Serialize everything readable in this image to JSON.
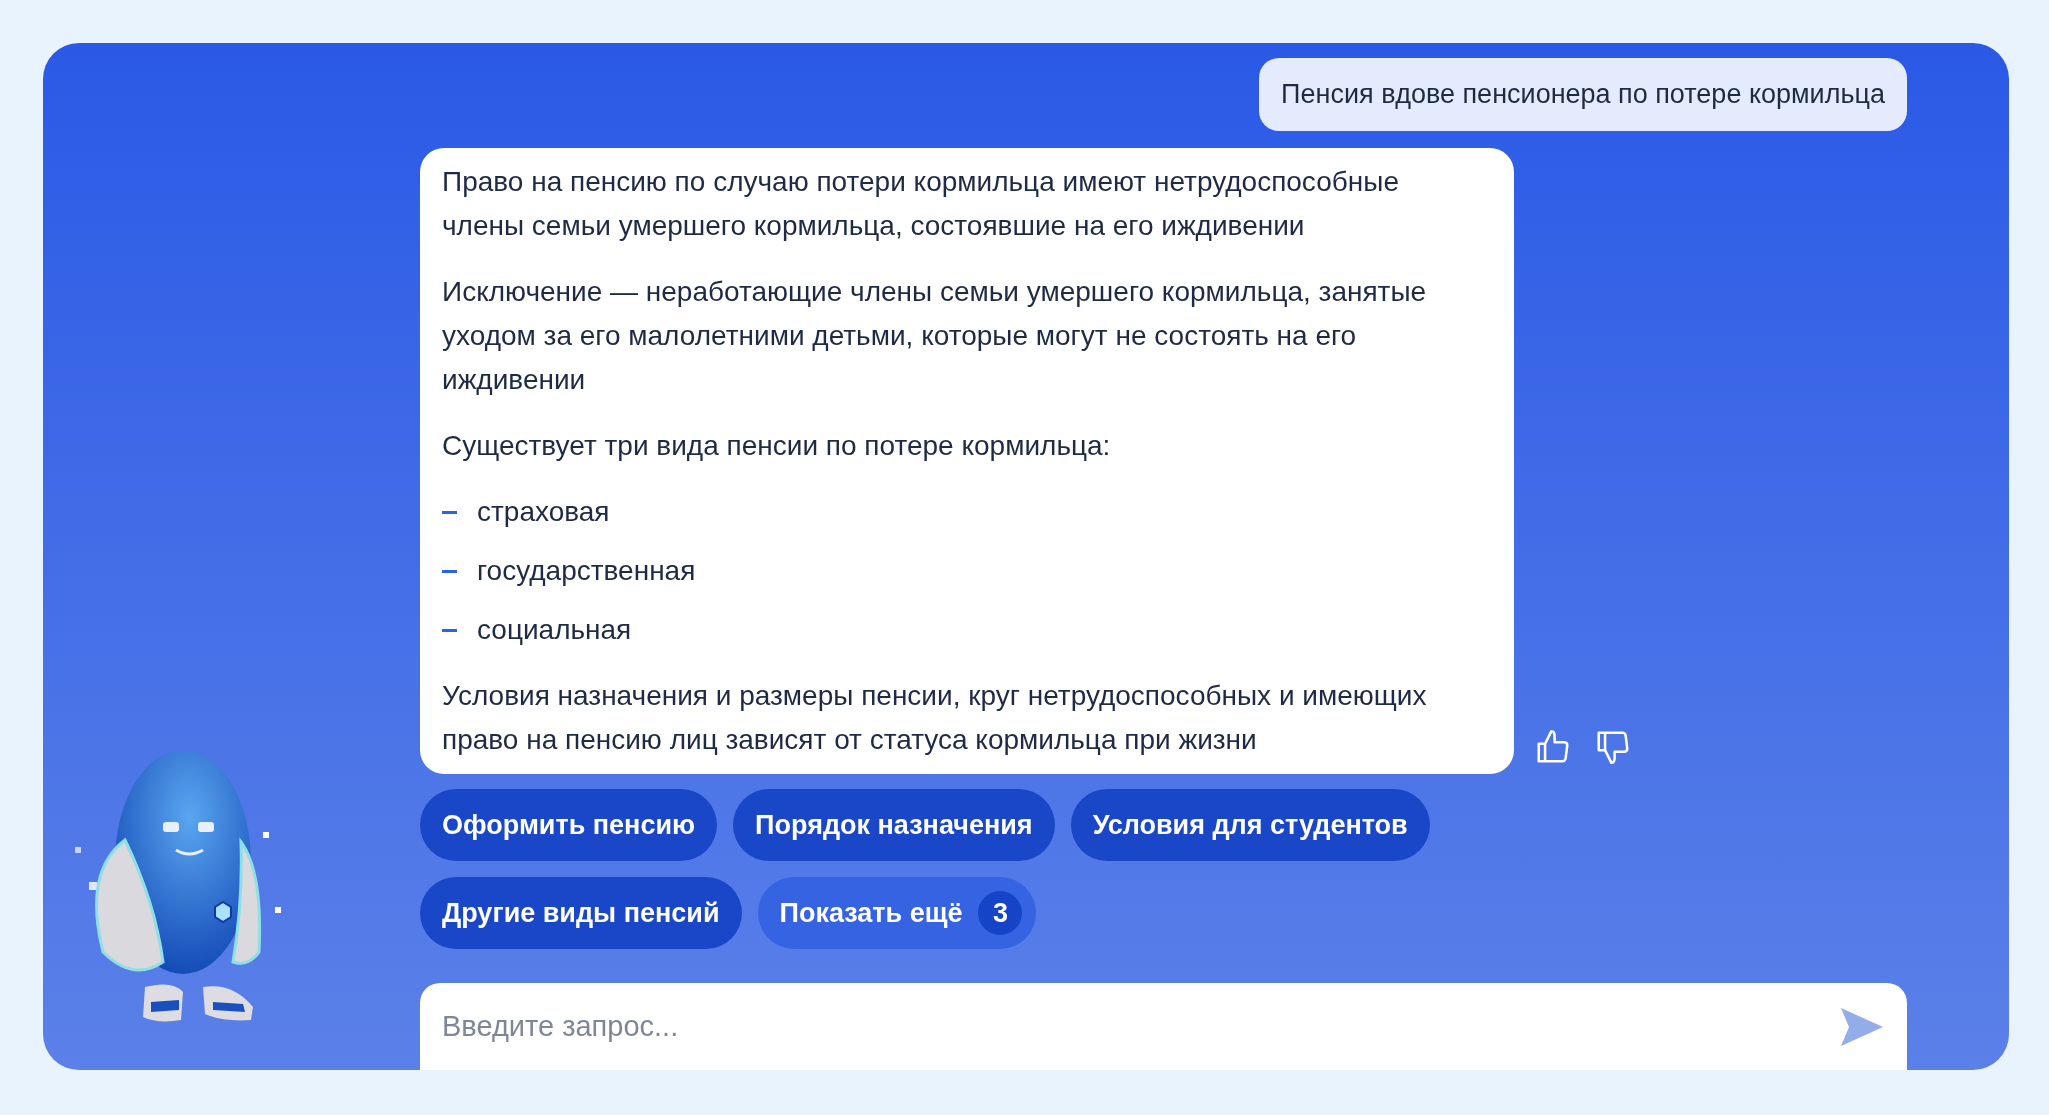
{
  "user_message": "Пенсия вдове пенсионера по потере кормильца",
  "answer": [
    {
      "kind": "paragraph",
      "text": "Право на пенсию по случаю потери кормильца имеют нетрудоспособные члены семьи умершего кормильца, состоявшие на его иждивении"
    },
    {
      "kind": "paragraph",
      "text": "Исключение — неработающие члены семьи умершего кормильца, занятые уходом за его малолетними детьми, которые могут не состоять на его иждивении"
    },
    {
      "kind": "paragraph",
      "text": "Существует три вида пенсии по потере кормильца:"
    },
    {
      "kind": "list",
      "items": [
        "страховая",
        "государственная",
        "социальная"
      ]
    },
    {
      "kind": "paragraph",
      "text": "Условия назначения и размеры пенсии, круг нетрудоспособных и имеющих право на пенсию лиц зависят от статуса кормильца при жизни"
    }
  ],
  "suggestions": [
    {
      "kind": "topic",
      "label": "Оформить пенсию"
    },
    {
      "kind": "topic",
      "label": "Порядок назначения"
    },
    {
      "kind": "topic",
      "label": "Условия для студентов"
    },
    {
      "kind": "topic",
      "label": "Другие виды пенсий"
    },
    {
      "kind": "more",
      "label": "Показать ещё",
      "count": "3"
    }
  ],
  "input": {
    "placeholder": "Введите запрос..."
  }
}
